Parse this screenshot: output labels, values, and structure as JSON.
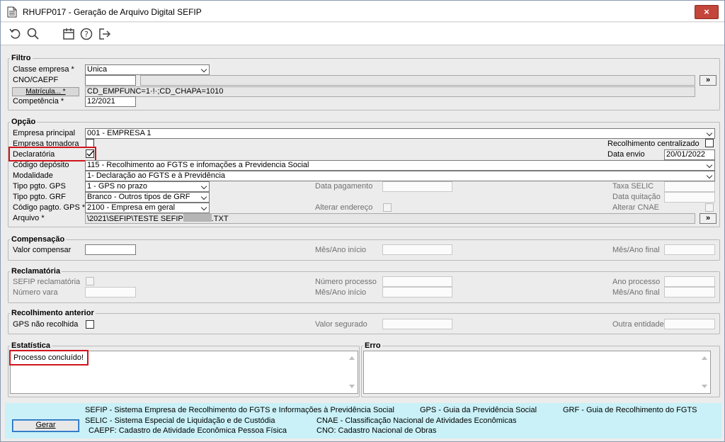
{
  "window": {
    "title": "RHUFP017 - Geração de Arquivo Digital SEFIP",
    "close_label": "×"
  },
  "toolbar": {
    "icons": [
      "undo-icon",
      "search-icon",
      "calendar-icon",
      "help-icon",
      "exit-icon"
    ]
  },
  "filtro": {
    "legend": "Filtro",
    "classe_empresa_label": "Classe empresa *",
    "classe_empresa_value": "Unica",
    "cno_caepf_label": "CNO/CAEPF",
    "cno_caepf_value": "",
    "matricula_label": "Matrícula... *",
    "matricula_value": "CD_EMPFUNC=1·!·;CD_CHAPA=1010",
    "competencia_label": "Competência *",
    "competencia_value": "12/2021",
    "lookup_label": "»"
  },
  "opcao": {
    "legend": "Opção",
    "empresa_principal_label": "Empresa principal",
    "empresa_principal_value": "001 - EMPRESA 1",
    "empresa_tomadora_label": "Empresa tomadora",
    "recolhimento_centralizado_label": "Recolhimento centralizado",
    "declaratoria_label": "Declaratória",
    "data_envio_label": "Data envio",
    "data_envio_value": "20/01/2022",
    "codigo_deposito_label": "Código depósito",
    "codigo_deposito_value": "115 - Recolhimento ao FGTS e infomações a Previdencia Social",
    "modalidade_label": "Modalidade",
    "modalidade_value": "1- Declaração ao FGTS e à Previdência",
    "tipo_gps_label": "Tipo pgto. GPS",
    "tipo_gps_value": "1 - GPS no prazo",
    "data_pagamento_label": "Data pagamento",
    "taxa_selic_label": "Taxa SELIC",
    "tipo_grf_label": "Tipo pgto. GRF",
    "tipo_grf_value": "Branco - Outros tipos de GRF",
    "data_quitacao_label": "Data quitação",
    "codigo_gps_label": "Código pagto. GPS *",
    "codigo_gps_value": "2100 - Empresa em geral",
    "alterar_endereco_label": "Alterar endereço",
    "alterar_cnae_label": "Alterar CNAE",
    "arquivo_label": "Arquivo *",
    "arquivo_prefix": "\\2021\\SEFIP\\TESTE SEFIP",
    "arquivo_suffix": ".TXT"
  },
  "compensacao": {
    "legend": "Compensação",
    "valor_label": "Valor compensar",
    "mes_inicio_label": "Mês/Ano início",
    "mes_final_label": "Mês/Ano final"
  },
  "reclamatoria": {
    "legend": "Reclamatória",
    "sefip_label": "SEFIP reclamatória",
    "numero_processo_label": "Número processo",
    "ano_processo_label": "Ano processo",
    "numero_vara_label": "Número vara",
    "mes_inicio_label": "Mês/Ano início",
    "mes_final_label": "Mês/Ano final"
  },
  "recolhimento": {
    "legend": "Recolhimento anterior",
    "gps_nao_recolhida_label": "GPS não recolhida",
    "valor_segurado_label": "Valor segurado",
    "outra_entidade_label": "Outra entidade"
  },
  "estatistica": {
    "legend": "Estatística",
    "text": "Processo concluído!"
  },
  "erro": {
    "legend": "Erro",
    "text": ""
  },
  "footer": {
    "gerar_label": "Gerar",
    "line1a": "SEFIP - Sistema Empresa de Recolhimento do FGTS e Informações à Previdência Social",
    "line1b": "GPS - Guia da Previdência Social",
    "line1c": "GRF - Guia de Recolhimento do FGTS",
    "line2a": "SELIC - Sistema Especial de Liquidação e de Custódia",
    "line2b": "CNAE - Classificação Nacional de Atividades Econômicas",
    "line3a": "CAEPF: Cadastro de Atividade Econômica Pessoa Física",
    "line3b": "CNO: Cadastro Nacional de Obras"
  },
  "colors": {
    "highlight": "#d0141c",
    "footer_bg": "#c9f1f7",
    "close_bg": "#c4453a"
  }
}
